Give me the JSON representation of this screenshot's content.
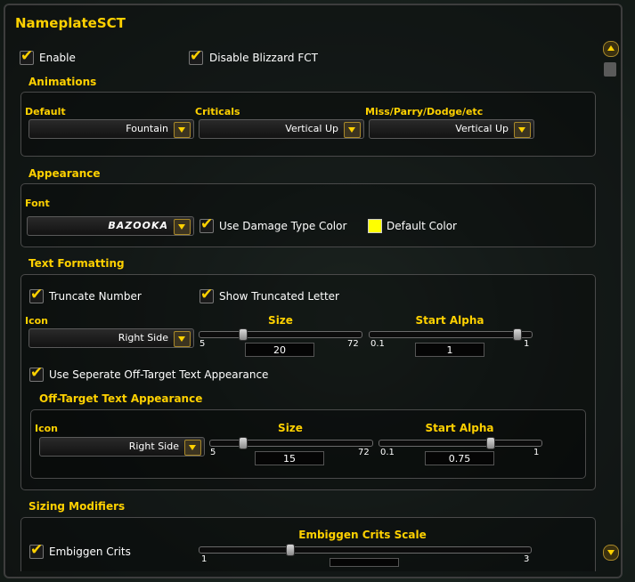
{
  "window": {
    "title": "NameplateSCT"
  },
  "general": {
    "enable_label": "Enable",
    "disable_fct_label": "Disable Blizzard FCT"
  },
  "animations": {
    "section_label": "Animations",
    "default_label": "Default",
    "default_value": "Fountain",
    "criticals_label": "Criticals",
    "criticals_value": "Vertical Up",
    "miss_label": "Miss/Parry/Dodge/etc",
    "miss_value": "Vertical Up"
  },
  "appearance": {
    "section_label": "Appearance",
    "font_label": "Font",
    "font_value": "BAZOOKA",
    "damage_type_color_label": "Use Damage Type Color",
    "default_color_label": "Default Color",
    "default_color": "#ffff00"
  },
  "text_formatting": {
    "section_label": "Text Formatting",
    "truncate_label": "Truncate Number",
    "show_truncated_label": "Show Truncated Letter",
    "icon_label": "Icon",
    "icon_value": "Right Side",
    "size_label": "Size",
    "size_min": "5",
    "size_max": "72",
    "size_value": "20",
    "alpha_label": "Start Alpha",
    "alpha_min": "0.1",
    "alpha_max": "1",
    "alpha_value": "1",
    "off_target_toggle_label": "Use Seperate Off-Target Text Appearance"
  },
  "off_target": {
    "section_label": "Off-Target Text Appearance",
    "icon_label": "Icon",
    "icon_value": "Right Side",
    "size_label": "Size",
    "size_min": "5",
    "size_max": "72",
    "size_value": "15",
    "alpha_label": "Start Alpha",
    "alpha_min": "0.1",
    "alpha_max": "1",
    "alpha_value": "0.75"
  },
  "sizing": {
    "section_label": "Sizing Modifiers",
    "embiggen_label": "Embiggen Crits",
    "scale_label": "Embiggen Crits Scale",
    "scale_min": "1",
    "scale_max": "3"
  },
  "colors": {
    "accent": "#ffd100",
    "panel_border": "#3d3d3d"
  }
}
